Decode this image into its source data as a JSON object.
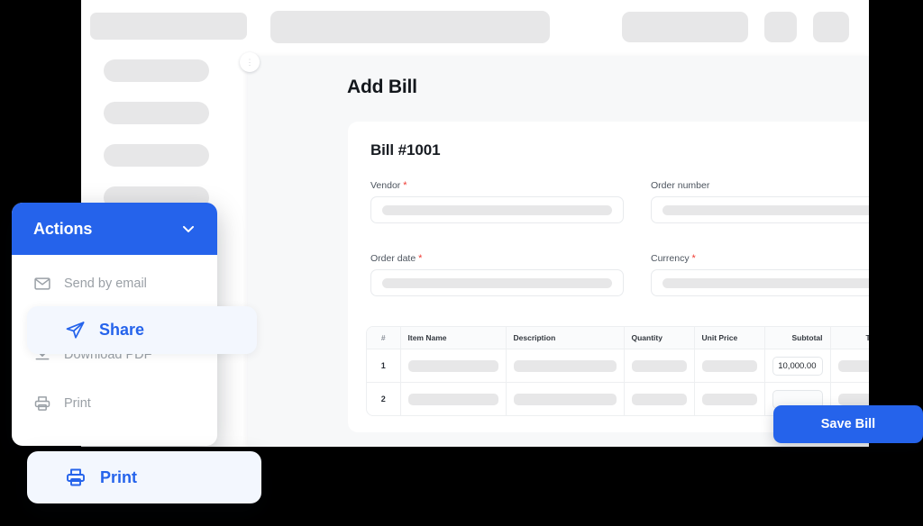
{
  "window": {
    "skeleton_topbar": [
      "logo-placeholder",
      "search-placeholder",
      "action-placeholder",
      "icon-placeholder-1",
      "icon-placeholder-2"
    ],
    "skeleton_sidebar_items": 6,
    "collapse_toggle_glyph": "⋮"
  },
  "main": {
    "page_title": "Add Bill",
    "card": {
      "bill_number": "Bill #1001",
      "fields": [
        {
          "label": "Vendor",
          "required": true,
          "value": "",
          "placeholder": ""
        },
        {
          "label": "Order number",
          "required": false,
          "value": "",
          "placeholder": ""
        },
        {
          "label": "Order date",
          "required": true,
          "value": "",
          "placeholder": ""
        },
        {
          "label": "Currency",
          "required": true,
          "value": "",
          "placeholder": ""
        }
      ],
      "required_marker": "*",
      "items_table": {
        "columns": [
          "#",
          "Item Name",
          "Description",
          "Quantity",
          "Unit Price",
          "Subtotal",
          "Tax",
          ""
        ],
        "rows": [
          {
            "index": "1",
            "item_name": "",
            "description": "",
            "quantity": "",
            "unit_price": "",
            "subtotal": "10,000.00",
            "subtotal_active": true,
            "tax": "",
            "delete_icon": "trash-icon"
          },
          {
            "index": "2",
            "item_name": "",
            "description": "",
            "quantity": "",
            "unit_price": "",
            "subtotal": "",
            "subtotal_active": false,
            "tax": "",
            "delete_icon": "trash-icon"
          }
        ]
      }
    }
  },
  "save_button": {
    "label": "Save Bill"
  },
  "actions_menu": {
    "title": "Actions",
    "chevron_icon": "chevron-down-icon",
    "items": [
      {
        "label": "Send by email",
        "icon": "envelope-icon",
        "state": "default"
      },
      {
        "label": "Download PDF",
        "icon": "download-icon",
        "state": "default"
      },
      {
        "label": "Print",
        "icon": "printer-icon",
        "state": "default"
      }
    ]
  },
  "floating_cards": [
    {
      "label": "Share",
      "icon": "send-icon",
      "state": "highlighted"
    },
    {
      "label": "Print",
      "icon": "printer-icon",
      "state": "highlighted"
    }
  ],
  "colors": {
    "brand_blue": "#2563eb",
    "highlight_bg": "#f3f7fe",
    "skeleton_gray": "#e7e7e8",
    "page_bg": "#f7f8f9",
    "required_red": "#ef3b34",
    "muted_text": "#9aa0a6",
    "backdrop": "#000000"
  }
}
